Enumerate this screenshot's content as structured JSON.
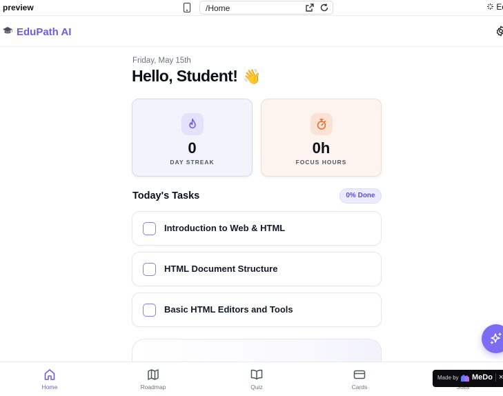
{
  "browser": {
    "preview_label": "preview",
    "url": "/Home",
    "edit_label": "Ed"
  },
  "header": {
    "brand": "EduPath AI"
  },
  "main": {
    "date": "Friday, May 15th",
    "greeting": "Hello, Student!",
    "greeting_emoji": "👋",
    "stats": [
      {
        "value": "0",
        "label": "DAY STREAK",
        "icon": "flame-icon"
      },
      {
        "value": "0h",
        "label": "FOCUS HOURS",
        "icon": "stopwatch-icon"
      }
    ],
    "tasks_title": "Today's Tasks",
    "done_badge": "0% Done",
    "tasks": [
      {
        "label": "Introduction to Web & HTML"
      },
      {
        "label": "HTML Document Structure"
      },
      {
        "label": "Basic HTML Editors and Tools"
      }
    ]
  },
  "nav": {
    "items": [
      {
        "label": "Home",
        "icon": "home-icon"
      },
      {
        "label": "Roadmap",
        "icon": "map-icon"
      },
      {
        "label": "Quiz",
        "icon": "book-open-icon"
      },
      {
        "label": "Cards",
        "icon": "credit-card-icon"
      },
      {
        "label": "Stats",
        "icon": "chart-icon"
      }
    ]
  },
  "badge": {
    "made_by": "Made by",
    "brand": "MeDo",
    "close": "×"
  },
  "colors": {
    "accent": "#6d5ce8",
    "fab": "#7c6cf2",
    "streak_bg": "#f3f4fb",
    "focus_bg": "#fdf4ef"
  }
}
